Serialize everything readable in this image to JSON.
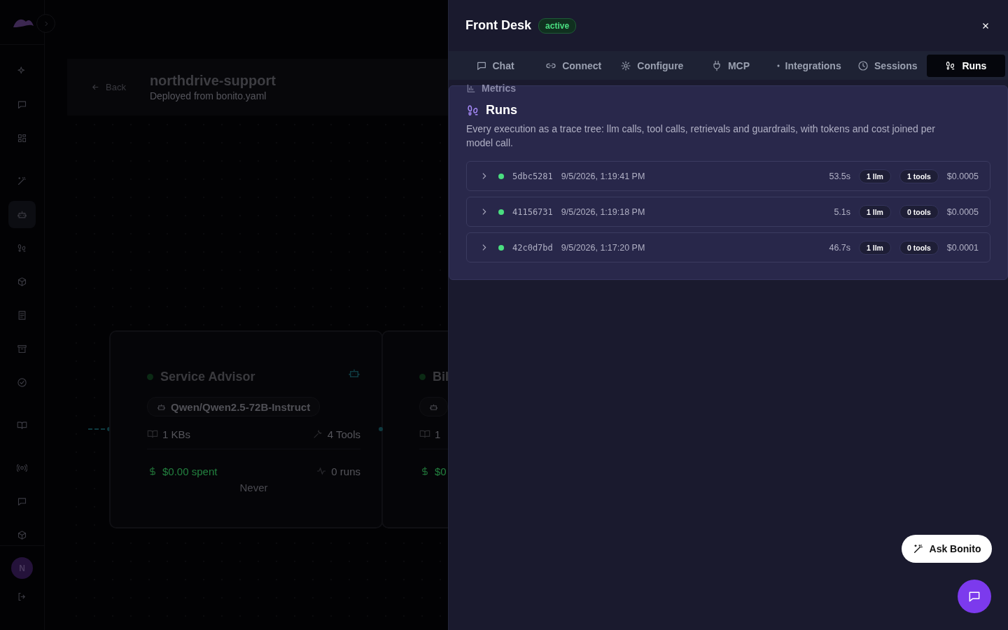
{
  "sidebar": {
    "items": [
      {
        "selected": false
      },
      {
        "selected": false
      },
      {
        "selected": false
      },
      {
        "selected": false
      },
      {
        "selected": true
      },
      {
        "selected": false
      },
      {
        "selected": false
      },
      {
        "selected": false
      },
      {
        "selected": false
      },
      {
        "selected": false
      },
      {
        "selected": false
      },
      {
        "selected": false
      },
      {
        "selected": false
      },
      {
        "selected": false
      }
    ],
    "avatar": "N"
  },
  "header": {
    "back": "Back",
    "title": "northdrive-support",
    "subtitle": "Deployed from bonito.yaml"
  },
  "cards": [
    {
      "name": "Service Advisor",
      "model": "Qwen/Qwen2.5-72B-Instruct",
      "kbs": "1 KBs",
      "tools": "4 Tools",
      "spent": "$0.00 spent",
      "runs": "0 runs",
      "last": "Never"
    },
    {
      "name": "Bil",
      "kbs": "1",
      "spent": "$0"
    }
  ],
  "drawer": {
    "title": "Front Desk",
    "status": "active",
    "tabs": [
      {
        "label": "Chat",
        "selected": false
      },
      {
        "label": "Connect",
        "selected": false
      },
      {
        "label": "Configure",
        "selected": false
      },
      {
        "label": "MCP",
        "selected": false
      },
      {
        "label": "Integrations",
        "selected": false
      },
      {
        "label": "Sessions",
        "selected": false
      },
      {
        "label": "Runs",
        "selected": true
      }
    ],
    "section_above": "Metrics",
    "heading": "Runs",
    "description": "Every execution as a trace tree: llm calls, tool calls, retrievals and guardrails, with tokens and cost joined per model call.",
    "runs": [
      {
        "id": "5dbc5281",
        "time": "9/5/2026, 1:19:41 PM",
        "duration": "53.5s",
        "llm": "1 llm",
        "tools": "1 tools",
        "cost": "$0.0005",
        "color": "#4ade80"
      },
      {
        "id": "41156731",
        "time": "9/5/2026, 1:19:18 PM",
        "duration": "5.1s",
        "llm": "1 llm",
        "tools": "0 tools",
        "cost": "$0.0005",
        "color": "#4ade80"
      },
      {
        "id": "42c0d7bd",
        "time": "9/5/2026, 1:17:20 PM",
        "duration": "46.7s",
        "llm": "1 llm",
        "tools": "0 tools",
        "cost": "$0.0001",
        "color": "#4ade80"
      }
    ],
    "ask_button": "Ask Bonito"
  }
}
